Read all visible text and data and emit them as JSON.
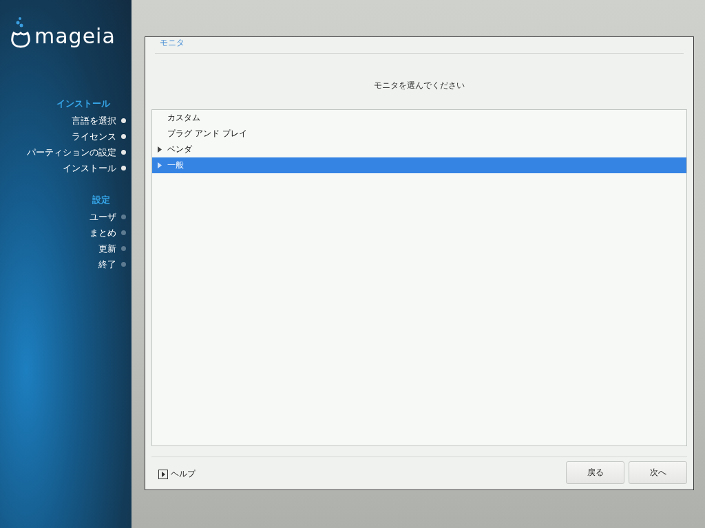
{
  "sidebar": {
    "logo": "mageia",
    "sections": [
      {
        "title": "インストール",
        "steps": [
          {
            "label": "言語を選択",
            "done": true
          },
          {
            "label": "ライセンス",
            "done": true
          },
          {
            "label": "パーティションの設定",
            "done": true
          },
          {
            "label": "インストール",
            "done": true
          }
        ]
      },
      {
        "title": "設定",
        "steps": [
          {
            "label": "ユーザ",
            "done": false
          },
          {
            "label": "まとめ",
            "done": false
          },
          {
            "label": "更新",
            "done": false
          },
          {
            "label": "終了",
            "done": false
          }
        ]
      }
    ]
  },
  "dialog": {
    "title": "モニタ",
    "prompt": "モニタを選んでください",
    "tree": [
      {
        "label": "カスタム",
        "kind": "leaf",
        "selected": false
      },
      {
        "label": "プラグ アンド プレイ",
        "kind": "leaf",
        "selected": false
      },
      {
        "label": "ベンダ",
        "kind": "branch",
        "expanded": false,
        "selected": false
      },
      {
        "label": "一般",
        "kind": "branch",
        "expanded": false,
        "selected": true
      }
    ],
    "help": "ヘルプ",
    "buttons": [
      "戻る",
      "次へ"
    ]
  }
}
